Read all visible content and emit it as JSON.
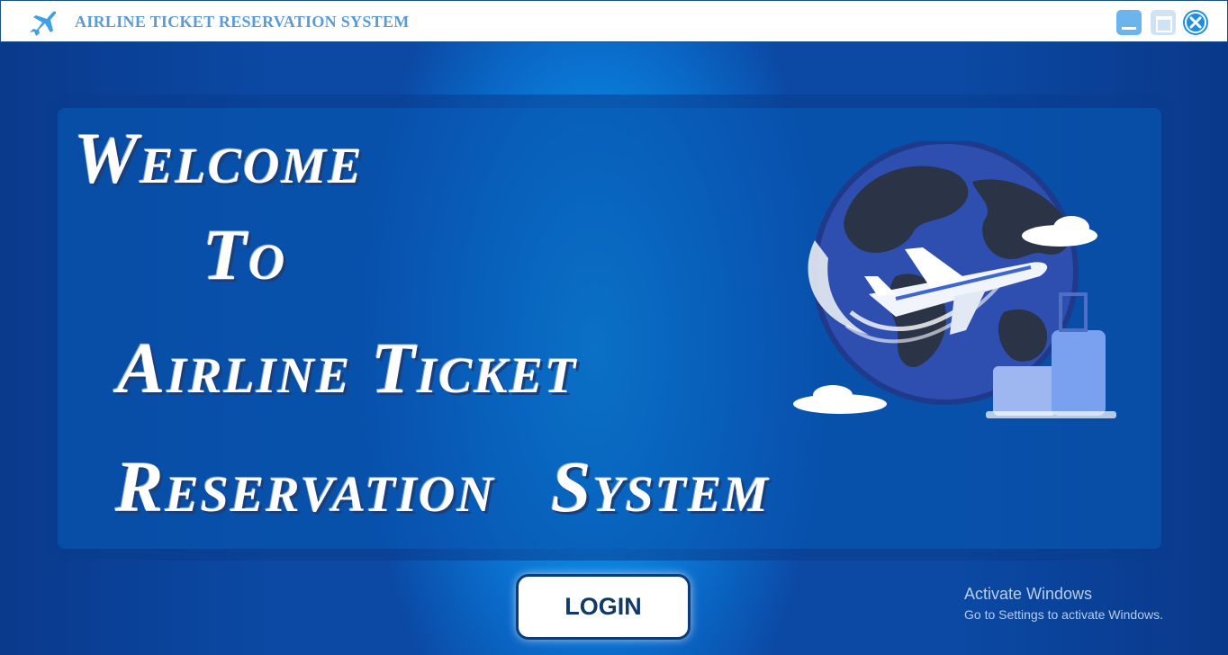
{
  "window": {
    "title": "AIRLINE TICKET RESERVATION SYSTEM",
    "app_icon": "airplane-icon",
    "controls": [
      "minimize",
      "maximize",
      "close"
    ]
  },
  "hero": {
    "line1": "Welcome",
    "line2": "To",
    "line3": "Airline Ticket",
    "line4": "Reservation System",
    "illustration": "globe-airplane-luggage-illustration"
  },
  "login_button": {
    "label": "LOGIN"
  },
  "watermark": {
    "line1": "Activate Windows",
    "line2": "Go to Settings to activate Windows."
  },
  "colors": {
    "background_center": "#12b4ff",
    "background_edge": "#0b49a4",
    "title_text": "#5b9bd5",
    "login_text": "#113a6b"
  }
}
